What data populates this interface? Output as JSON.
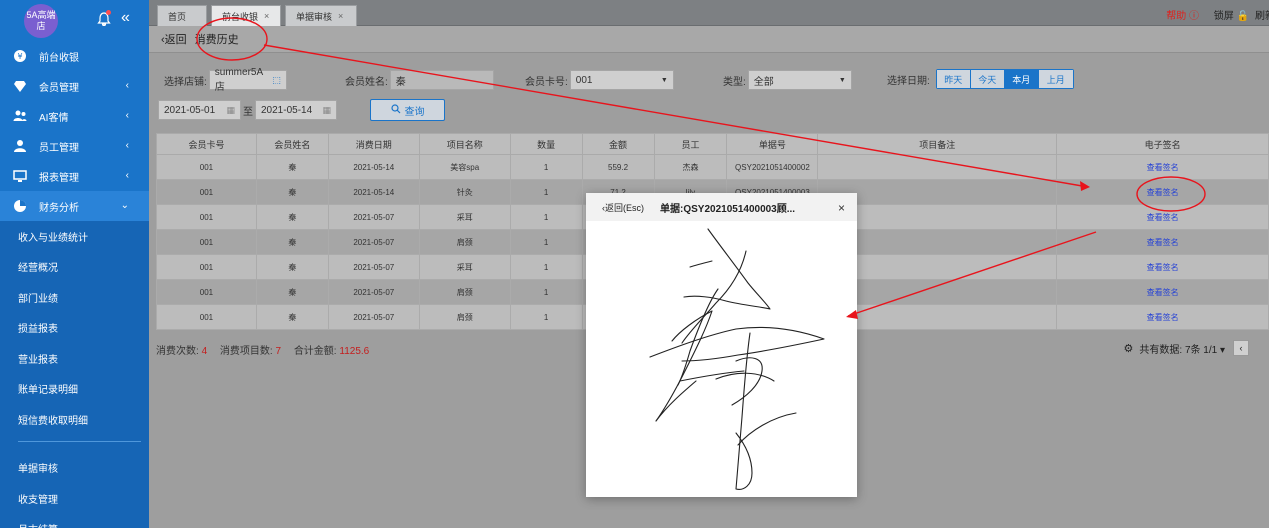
{
  "sidebar": {
    "logo": "5A高端店",
    "menu": [
      {
        "label": "前台收银",
        "icon": "cashier-icon",
        "arrow": ""
      },
      {
        "label": "会员管理",
        "icon": "diamond-icon",
        "arrow": "‹"
      },
      {
        "label": "AI客情",
        "icon": "people-icon",
        "arrow": "‹"
      },
      {
        "label": "员工管理",
        "icon": "user-icon",
        "arrow": "‹"
      },
      {
        "label": "报表管理",
        "icon": "monitor-icon",
        "arrow": "‹"
      },
      {
        "label": "财务分析",
        "icon": "pie-chart-icon",
        "arrow": "⌄"
      }
    ],
    "sub_items": [
      "收入与业绩统计",
      "经营概况",
      "部门业绩",
      "损益报表",
      "营业报表",
      "账单记录明细",
      "短信费收取明细"
    ],
    "sub_items2": [
      "单据审核",
      "收支管理",
      "月末结算"
    ]
  },
  "tabs": [
    {
      "label": "首页",
      "close": ""
    },
    {
      "label": "前台收银",
      "close": "×"
    },
    {
      "label": "单据审核",
      "close": "×"
    }
  ],
  "topbar": {
    "help": "帮助 ⓘ",
    "lock": "锁屏 🔓",
    "refresh": "刷新"
  },
  "subhead": {
    "back": "‹返回",
    "title": "消费历史"
  },
  "filters": {
    "store_label": "选择店铺:",
    "store_value": "summer5A店",
    "member_name_label": "会员姓名:",
    "member_name_value": "秦",
    "card_label": "会员卡号:",
    "card_value": "001",
    "type_label": "类型:",
    "type_value": "全部",
    "date_label": "选择日期:",
    "ranges": [
      "昨天",
      "今天",
      "本月",
      "上月"
    ],
    "date_from": "2021-05-01",
    "date_to_sep": "至",
    "date_to": "2021-05-14",
    "query": "查询"
  },
  "table": {
    "headers": [
      "会员卡号",
      "会员姓名",
      "消费日期",
      "项目名称",
      "数量",
      "金额",
      "员工",
      "单据号",
      "项目备注",
      "电子签名"
    ],
    "rows": [
      [
        "001",
        "秦",
        "2021-05-14",
        "美容spa",
        "1",
        "559.2",
        "杰森",
        "QSY2021051400002",
        "",
        "查看签名"
      ],
      [
        "001",
        "秦",
        "2021-05-14",
        "针灸",
        "1",
        "71.2",
        "lily",
        "QSY2021051400003",
        "",
        "查看签名"
      ],
      [
        "001",
        "秦",
        "2021-05-07",
        "采耳",
        "1",
        "",
        "",
        "",
        "",
        "查看签名"
      ],
      [
        "001",
        "秦",
        "2021-05-07",
        "肩颈",
        "1",
        "",
        "",
        "",
        "",
        "查看签名"
      ],
      [
        "001",
        "秦",
        "2021-05-07",
        "采耳",
        "1",
        "",
        "",
        "",
        "",
        "查看签名"
      ],
      [
        "001",
        "秦",
        "2021-05-07",
        "肩颈",
        "1",
        "",
        "",
        "",
        "",
        "查看签名"
      ],
      [
        "001",
        "秦",
        "2021-05-07",
        "肩颈",
        "1",
        "",
        "",
        "",
        "",
        "查看签名"
      ]
    ]
  },
  "summary": {
    "count_label": "消费次数:",
    "count": "4",
    "items_label": "消费项目数:",
    "items": "7",
    "total_label": "合计金额:",
    "total": "1125.6"
  },
  "pager": {
    "text": "共有数据: 7条 1/1 ▾",
    "prev": "‹"
  },
  "modal": {
    "back": "‹返回(Esc)",
    "title": "单据:QSY2021051400003顾...",
    "close": "×"
  }
}
